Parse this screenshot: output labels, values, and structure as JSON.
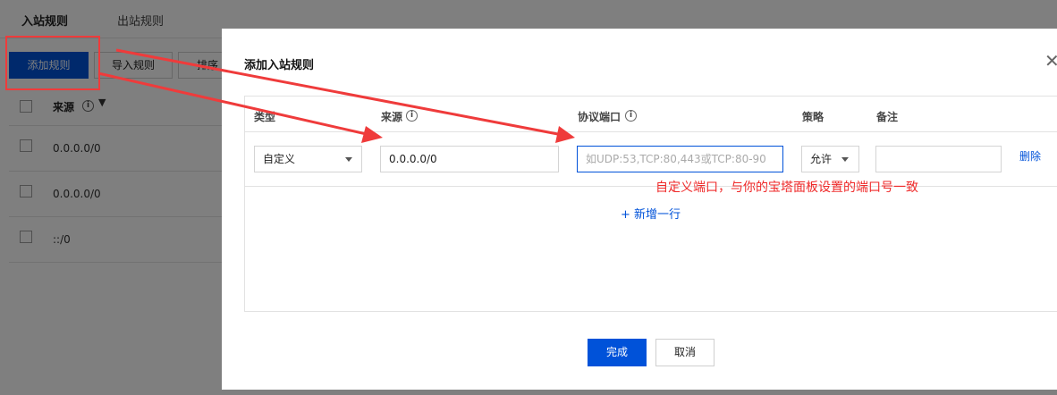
{
  "page_tabs": [
    {
      "label": "入站规则",
      "active": true
    },
    {
      "label": "出站规则",
      "active": false
    }
  ],
  "toolbar": {
    "add_rule": "添加规则",
    "import_rule": "导入规则",
    "sort": "排序"
  },
  "bg_table": {
    "col_source": "来源",
    "rows": [
      "0.0.0.0/0",
      "0.0.0.0/0",
      "::/0"
    ]
  },
  "dialog": {
    "title": "添加入站规则",
    "close_icon": "close-icon",
    "columns": {
      "type": "类型",
      "source": "来源",
      "port": "协议端口",
      "policy": "策略",
      "note": "备注"
    },
    "row": {
      "type_value": "自定义",
      "source_value": "0.0.0.0/0",
      "port_placeholder": "如UDP:53,TCP:80,443或TCP:80-90",
      "policy_value": "允许",
      "note_value": "",
      "delete_label": "删除"
    },
    "add_row": "+ 新增一行",
    "confirm_label": "完成",
    "cancel_label": "取消"
  },
  "annotation": {
    "text": "自定义端口，与你的宝塔面板设置的端口号一致",
    "color": "#ef2a2a"
  },
  "colors": {
    "primary": "#0052d9",
    "overlay": "rgba(0,0,0,0.5)"
  }
}
